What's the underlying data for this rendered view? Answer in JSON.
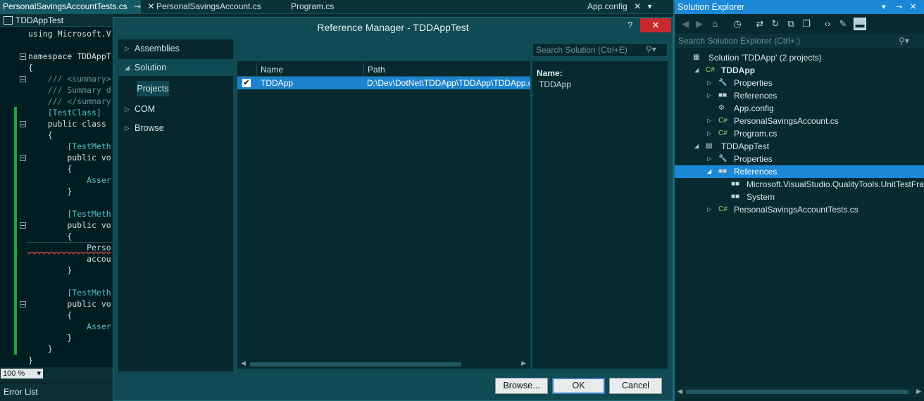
{
  "editor_tabs": {
    "tab1_label": "PersonalSavingsAccountTests.cs",
    "tab1_pin": "⊸",
    "tab1_close": "✕",
    "tab2_label": "PersonalSavingsAccount.cs",
    "tab3_label": "Program.cs",
    "tab4_label": "App.config",
    "tab4_close": "✕",
    "dropdown": "▾"
  },
  "nav_dropdown": {
    "label": "TDDAppTest"
  },
  "code_lines": [
    {
      "t": "using Microsoft.V",
      "c": "pl"
    },
    {
      "t": "",
      "c": "pl"
    },
    {
      "t": "namespace TDDAppT",
      "c": "pl"
    },
    {
      "t": "{",
      "c": "pl"
    },
    {
      "t": "    /// <summary>",
      "c": "cm"
    },
    {
      "t": "    /// Summary d",
      "c": "cm"
    },
    {
      "t": "    /// </summary",
      "c": "cm"
    },
    {
      "t": "    [TestClass]",
      "c": "at"
    },
    {
      "t": "    public class ",
      "c": "pl"
    },
    {
      "t": "    {",
      "c": "pl"
    },
    {
      "t": "        [TestMeth",
      "c": "at"
    },
    {
      "t": "        public vo",
      "c": "pl"
    },
    {
      "t": "        {",
      "c": "pl"
    },
    {
      "t": "            Asser",
      "c": "at"
    },
    {
      "t": "        }",
      "c": "pl"
    },
    {
      "t": "",
      "c": "pl"
    },
    {
      "t": "        [TestMeth",
      "c": "at"
    },
    {
      "t": "        public vo",
      "c": "pl"
    },
    {
      "t": "        {",
      "c": "pl"
    },
    {
      "t": "            Perso",
      "c": "pl squig"
    },
    {
      "t": "            accou",
      "c": "pl"
    },
    {
      "t": "        }",
      "c": "pl"
    },
    {
      "t": "",
      "c": "pl"
    },
    {
      "t": "        [TestMeth",
      "c": "at"
    },
    {
      "t": "        public vo",
      "c": "pl"
    },
    {
      "t": "        {",
      "c": "pl"
    },
    {
      "t": "            Asser",
      "c": "at"
    },
    {
      "t": "        }",
      "c": "pl"
    },
    {
      "t": "    }",
      "c": "pl"
    },
    {
      "t": "}",
      "c": "pl"
    }
  ],
  "zoom": {
    "value": "100 %",
    "arrow": "▾"
  },
  "error_list": {
    "label": "Error List"
  },
  "dialog": {
    "title": "Reference Manager - TDDAppTest",
    "help": "?",
    "close": "✕",
    "nav": {
      "assemblies": "Assemblies",
      "solution": "Solution",
      "projects": "Projects",
      "com": "COM",
      "browse": "Browse",
      "arrow_collapsed": "▷",
      "arrow_expanded": "◢"
    },
    "search_placeholder": "Search Solution (Ctrl+E)",
    "search_icon": "⚲▾",
    "columns": {
      "name": "Name",
      "path": "Path"
    },
    "rows": [
      {
        "checked": "✔",
        "name": "TDDApp",
        "path": "D:\\Dev\\DotNet\\TDDApp\\TDDApp\\TDDApp.csproj"
      }
    ],
    "scroll_left": "◀",
    "scroll_right": "▶",
    "details": {
      "name_label": "Name:",
      "name_value": "TDDApp"
    },
    "buttons": {
      "browse": "Browse...",
      "ok": "OK",
      "cancel": "Cancel"
    }
  },
  "solution_explorer": {
    "title": "Solution Explorer",
    "title_dropdown": "▾",
    "title_pin": "⊸",
    "title_close": "✕",
    "search_placeholder": "Search Solution Explorer (Ctrl+;)",
    "search_icon": "⚲▾",
    "toolbar_icons": [
      "back-icon",
      "forward-icon",
      "home-icon",
      "history-icon",
      "sync-icon",
      "refresh-icon",
      "collapse-all-icon",
      "show-all-files-icon",
      "view-code-icon",
      "properties-icon",
      "preview-icon"
    ],
    "tree": [
      {
        "label": "Solution 'TDDApp' (2 projects)",
        "exp": "",
        "icon": "▦",
        "bold": false
      },
      {
        "label": "TDDApp",
        "exp": "◢",
        "icon": "C#",
        "bold": true
      },
      {
        "label": "Properties",
        "exp": "▷",
        "icon": "🔧",
        "bold": false
      },
      {
        "label": "References",
        "exp": "▷",
        "icon": "■■",
        "bold": false
      },
      {
        "label": "App.config",
        "exp": "",
        "icon": "⚙",
        "bold": false
      },
      {
        "label": "PersonalSavingsAccount.cs",
        "exp": "▷",
        "icon": "C#",
        "bold": false
      },
      {
        "label": "Program.cs",
        "exp": "▷",
        "icon": "C#",
        "bold": false
      },
      {
        "label": "TDDAppTest",
        "exp": "◢",
        "icon": "▤",
        "bold": false
      },
      {
        "label": "Properties",
        "exp": "▷",
        "icon": "🔧",
        "bold": false
      },
      {
        "label": "References",
        "exp": "◢",
        "icon": "■■",
        "bold": false
      },
      {
        "label": "Microsoft.VisualStudio.QualityTools.UnitTestFramework",
        "exp": "",
        "icon": "■■",
        "bold": false
      },
      {
        "label": "System",
        "exp": "",
        "icon": "■■",
        "bold": false
      },
      {
        "label": "PersonalSavingsAccountTests.cs",
        "exp": "▷",
        "icon": "C#",
        "bold": false
      }
    ],
    "scroll_left": "◀",
    "scroll_right": "▶"
  },
  "colors": {
    "accent_blue": "#1a88d6",
    "close_red": "#c9282d",
    "change_green": "#1fa53a",
    "dialog_bg": "#104a54"
  }
}
